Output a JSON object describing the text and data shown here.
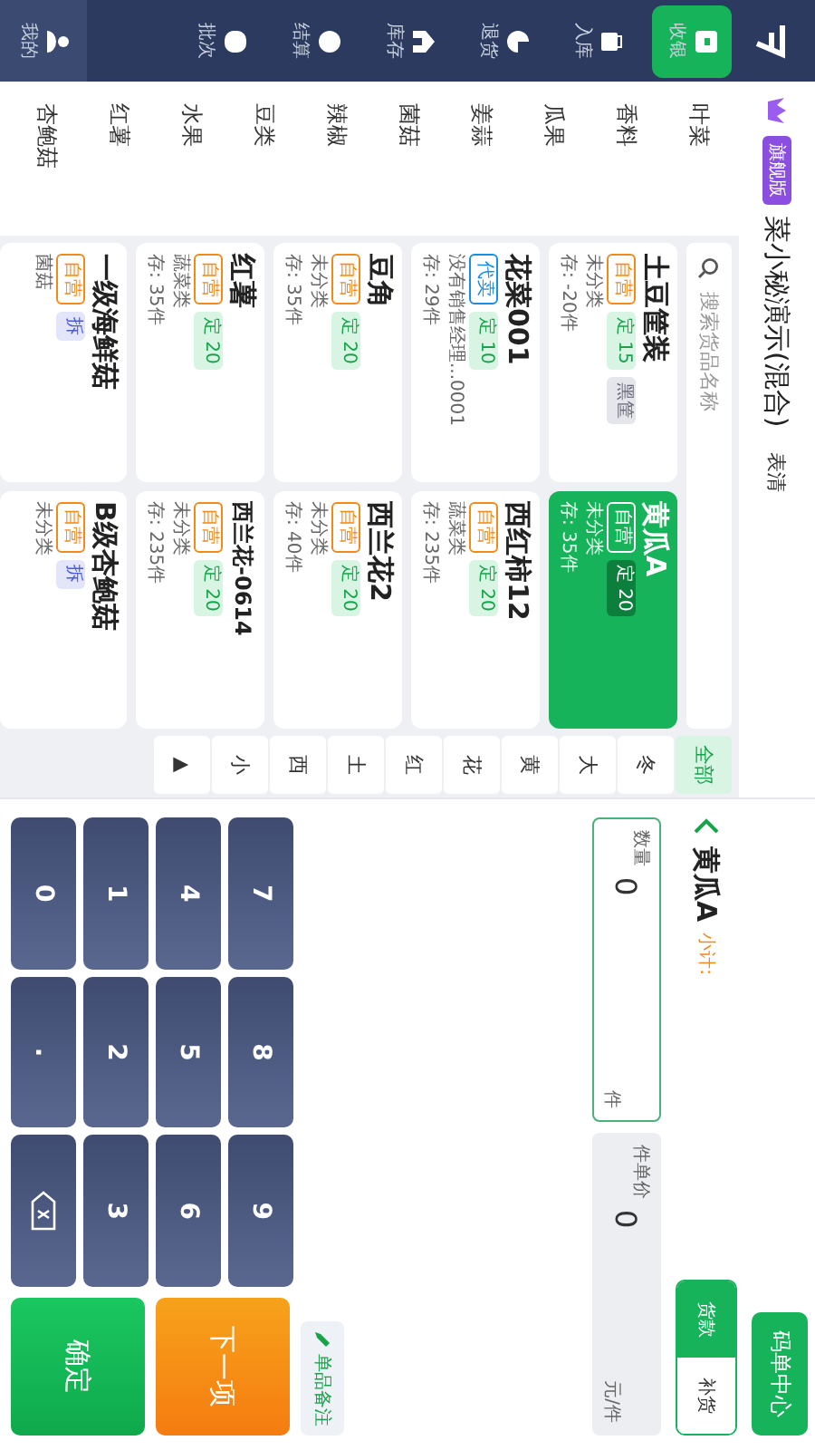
{
  "nav": {
    "items": [
      {
        "label": "收银",
        "selected": true
      },
      {
        "label": "入库",
        "selected": false
      },
      {
        "label": "退货",
        "selected": false
      },
      {
        "label": "库存",
        "selected": false
      },
      {
        "label": "结算",
        "selected": false
      },
      {
        "label": "批次",
        "selected": false
      },
      {
        "label": "我的",
        "selected": false
      }
    ]
  },
  "header": {
    "store": "菜小秘演示(混合)",
    "badge": "旗舰版",
    "action": "表清"
  },
  "categories": [
    "叶菜",
    "香料",
    "瓜果",
    "姜蒜",
    "菌菇",
    "辣椒",
    "豆类",
    "水果",
    "红薯",
    "杏鲍菇"
  ],
  "search": {
    "placeholder": "搜索货品名称"
  },
  "products": [
    {
      "name": "土豆筐装",
      "selected": false,
      "tags": [
        {
          "kind": "self",
          "text": "自营"
        },
        {
          "kind": "fixed",
          "text": "定 15"
        },
        {
          "kind": "basket",
          "text": "黑筐"
        }
      ],
      "category": "未分类",
      "stock": "存: -20件"
    },
    {
      "name": "黄瓜A",
      "selected": true,
      "tags": [
        {
          "kind": "self",
          "text": "自营"
        },
        {
          "kind": "fixed",
          "text": "定 20"
        }
      ],
      "category": "未分类",
      "stock": "存: 35件"
    },
    {
      "name": "花菜001",
      "selected": false,
      "tags": [
        {
          "kind": "agent",
          "text": "代卖"
        },
        {
          "kind": "fixed",
          "text": "定 10"
        }
      ],
      "category": "没有销售经理...0001",
      "stock": "存: 29件"
    },
    {
      "name": "西红柿12",
      "selected": false,
      "tags": [
        {
          "kind": "self",
          "text": "自营"
        },
        {
          "kind": "fixed",
          "text": "定 20"
        }
      ],
      "category": "蔬菜类",
      "stock": "存: 235件"
    },
    {
      "name": "豆角",
      "selected": false,
      "tags": [
        {
          "kind": "self",
          "text": "自营"
        },
        {
          "kind": "fixed",
          "text": "定 20"
        }
      ],
      "category": "未分类",
      "stock": "存: 35件"
    },
    {
      "name": "西兰花2",
      "selected": false,
      "tags": [
        {
          "kind": "self",
          "text": "自营"
        },
        {
          "kind": "fixed",
          "text": "定 20"
        }
      ],
      "category": "未分类",
      "stock": "存: 40件"
    },
    {
      "name": "红薯",
      "selected": false,
      "tags": [
        {
          "kind": "self",
          "text": "自营"
        },
        {
          "kind": "fixed",
          "text": "定 20"
        }
      ],
      "category": "蔬菜类",
      "stock": "存: 35件"
    },
    {
      "name": "西兰花-0614",
      "small": true,
      "selected": false,
      "tags": [
        {
          "kind": "self",
          "text": "自营"
        },
        {
          "kind": "fixed",
          "text": "定 20"
        }
      ],
      "category": "未分类",
      "stock": "存: 235件"
    },
    {
      "name": "一级海鲜菇",
      "selected": false,
      "tags": [
        {
          "kind": "self",
          "text": "自营"
        },
        {
          "kind": "split",
          "text": "拆"
        }
      ],
      "category": "菌菇"
    },
    {
      "name": "B级杏鲍菇",
      "selected": false,
      "tags": [
        {
          "kind": "self",
          "text": "自营"
        },
        {
          "kind": "split",
          "text": "拆"
        }
      ],
      "category": "未分类"
    }
  ],
  "letters": [
    {
      "label": "全部",
      "selected": true
    },
    {
      "label": "冬",
      "selected": false
    },
    {
      "label": "大",
      "selected": false
    },
    {
      "label": "黄",
      "selected": false
    },
    {
      "label": "花",
      "selected": false
    },
    {
      "label": "红",
      "selected": false
    },
    {
      "label": "土",
      "selected": false
    },
    {
      "label": "西",
      "selected": false
    },
    {
      "label": "小",
      "selected": false
    },
    {
      "label": "▲",
      "selected": false
    }
  ],
  "order": {
    "center_button": "码单中心",
    "title": "黄瓜A",
    "subtotal": "小计:",
    "modes": [
      {
        "label": "货款",
        "selected": true
      },
      {
        "label": "补货",
        "selected": false
      }
    ],
    "fields": [
      {
        "label": "数量",
        "value": "0",
        "unit": "件",
        "focused": true
      },
      {
        "label": "件单价",
        "value": "0",
        "unit": "元/件",
        "focused": false
      }
    ],
    "keys": [
      "7",
      "8",
      "9",
      "4",
      "5",
      "6",
      "1",
      "2",
      "3",
      "0",
      ".",
      {
        "kind": "backspace"
      }
    ],
    "note_button": "单品备注",
    "next_button": "下一项",
    "confirm_button": "确定"
  }
}
